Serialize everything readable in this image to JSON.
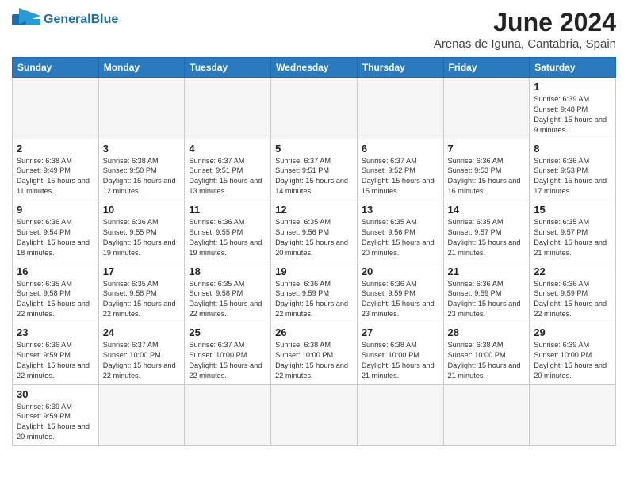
{
  "header": {
    "logo_general": "General",
    "logo_blue": "Blue",
    "title": "June 2024",
    "subtitle": "Arenas de Iguna, Cantabria, Spain"
  },
  "weekdays": [
    "Sunday",
    "Monday",
    "Tuesday",
    "Wednesday",
    "Thursday",
    "Friday",
    "Saturday"
  ],
  "weeks": [
    [
      {
        "day": "",
        "empty": true
      },
      {
        "day": "",
        "empty": true
      },
      {
        "day": "",
        "empty": true
      },
      {
        "day": "",
        "empty": true
      },
      {
        "day": "",
        "empty": true
      },
      {
        "day": "",
        "empty": true
      },
      {
        "day": "1",
        "sunrise": "Sunrise: 6:39 AM",
        "sunset": "Sunset: 9:48 PM",
        "daylight": "Daylight: 15 hours and 9 minutes."
      }
    ],
    [
      {
        "day": "2",
        "sunrise": "Sunrise: 6:38 AM",
        "sunset": "Sunset: 9:49 PM",
        "daylight": "Daylight: 15 hours and 11 minutes."
      },
      {
        "day": "3",
        "sunrise": "Sunrise: 6:38 AM",
        "sunset": "Sunset: 9:50 PM",
        "daylight": "Daylight: 15 hours and 12 minutes."
      },
      {
        "day": "4",
        "sunrise": "Sunrise: 6:37 AM",
        "sunset": "Sunset: 9:51 PM",
        "daylight": "Daylight: 15 hours and 13 minutes."
      },
      {
        "day": "5",
        "sunrise": "Sunrise: 6:37 AM",
        "sunset": "Sunset: 9:51 PM",
        "daylight": "Daylight: 15 hours and 14 minutes."
      },
      {
        "day": "6",
        "sunrise": "Sunrise: 6:37 AM",
        "sunset": "Sunset: 9:52 PM",
        "daylight": "Daylight: 15 hours and 15 minutes."
      },
      {
        "day": "7",
        "sunrise": "Sunrise: 6:36 AM",
        "sunset": "Sunset: 9:53 PM",
        "daylight": "Daylight: 15 hours and 16 minutes."
      },
      {
        "day": "8",
        "sunrise": "Sunrise: 6:36 AM",
        "sunset": "Sunset: 9:53 PM",
        "daylight": "Daylight: 15 hours and 17 minutes."
      }
    ],
    [
      {
        "day": "9",
        "sunrise": "Sunrise: 6:36 AM",
        "sunset": "Sunset: 9:54 PM",
        "daylight": "Daylight: 15 hours and 18 minutes."
      },
      {
        "day": "10",
        "sunrise": "Sunrise: 6:36 AM",
        "sunset": "Sunset: 9:55 PM",
        "daylight": "Daylight: 15 hours and 19 minutes."
      },
      {
        "day": "11",
        "sunrise": "Sunrise: 6:36 AM",
        "sunset": "Sunset: 9:55 PM",
        "daylight": "Daylight: 15 hours and 19 minutes."
      },
      {
        "day": "12",
        "sunrise": "Sunrise: 6:35 AM",
        "sunset": "Sunset: 9:56 PM",
        "daylight": "Daylight: 15 hours and 20 minutes."
      },
      {
        "day": "13",
        "sunrise": "Sunrise: 6:35 AM",
        "sunset": "Sunset: 9:56 PM",
        "daylight": "Daylight: 15 hours and 20 minutes."
      },
      {
        "day": "14",
        "sunrise": "Sunrise: 6:35 AM",
        "sunset": "Sunset: 9:57 PM",
        "daylight": "Daylight: 15 hours and 21 minutes."
      },
      {
        "day": "15",
        "sunrise": "Sunrise: 6:35 AM",
        "sunset": "Sunset: 9:57 PM",
        "daylight": "Daylight: 15 hours and 21 minutes."
      }
    ],
    [
      {
        "day": "16",
        "sunrise": "Sunrise: 6:35 AM",
        "sunset": "Sunset: 9:58 PM",
        "daylight": "Daylight: 15 hours and 22 minutes."
      },
      {
        "day": "17",
        "sunrise": "Sunrise: 6:35 AM",
        "sunset": "Sunset: 9:58 PM",
        "daylight": "Daylight: 15 hours and 22 minutes."
      },
      {
        "day": "18",
        "sunrise": "Sunrise: 6:35 AM",
        "sunset": "Sunset: 9:58 PM",
        "daylight": "Daylight: 15 hours and 22 minutes."
      },
      {
        "day": "19",
        "sunrise": "Sunrise: 6:36 AM",
        "sunset": "Sunset: 9:59 PM",
        "daylight": "Daylight: 15 hours and 22 minutes."
      },
      {
        "day": "20",
        "sunrise": "Sunrise: 6:36 AM",
        "sunset": "Sunset: 9:59 PM",
        "daylight": "Daylight: 15 hours and 23 minutes."
      },
      {
        "day": "21",
        "sunrise": "Sunrise: 6:36 AM",
        "sunset": "Sunset: 9:59 PM",
        "daylight": "Daylight: 15 hours and 23 minutes."
      },
      {
        "day": "22",
        "sunrise": "Sunrise: 6:36 AM",
        "sunset": "Sunset: 9:59 PM",
        "daylight": "Daylight: 15 hours and 22 minutes."
      }
    ],
    [
      {
        "day": "23",
        "sunrise": "Sunrise: 6:36 AM",
        "sunset": "Sunset: 9:59 PM",
        "daylight": "Daylight: 15 hours and 22 minutes."
      },
      {
        "day": "24",
        "sunrise": "Sunrise: 6:37 AM",
        "sunset": "Sunset: 10:00 PM",
        "daylight": "Daylight: 15 hours and 22 minutes."
      },
      {
        "day": "25",
        "sunrise": "Sunrise: 6:37 AM",
        "sunset": "Sunset: 10:00 PM",
        "daylight": "Daylight: 15 hours and 22 minutes."
      },
      {
        "day": "26",
        "sunrise": "Sunrise: 6:38 AM",
        "sunset": "Sunset: 10:00 PM",
        "daylight": "Daylight: 15 hours and 22 minutes."
      },
      {
        "day": "27",
        "sunrise": "Sunrise: 6:38 AM",
        "sunset": "Sunset: 10:00 PM",
        "daylight": "Daylight: 15 hours and 21 minutes."
      },
      {
        "day": "28",
        "sunrise": "Sunrise: 6:38 AM",
        "sunset": "Sunset: 10:00 PM",
        "daylight": "Daylight: 15 hours and 21 minutes."
      },
      {
        "day": "29",
        "sunrise": "Sunrise: 6:39 AM",
        "sunset": "Sunset: 10:00 PM",
        "daylight": "Daylight: 15 hours and 20 minutes."
      }
    ],
    [
      {
        "day": "30",
        "sunrise": "Sunrise: 6:39 AM",
        "sunset": "Sunset: 9:59 PM",
        "daylight": "Daylight: 15 hours and 20 minutes."
      },
      {
        "day": "",
        "empty": true
      },
      {
        "day": "",
        "empty": true
      },
      {
        "day": "",
        "empty": true
      },
      {
        "day": "",
        "empty": true
      },
      {
        "day": "",
        "empty": true
      },
      {
        "day": "",
        "empty": true
      }
    ]
  ],
  "colors": {
    "header_bg": "#2a7abf",
    "accent": "#1a6faf"
  }
}
